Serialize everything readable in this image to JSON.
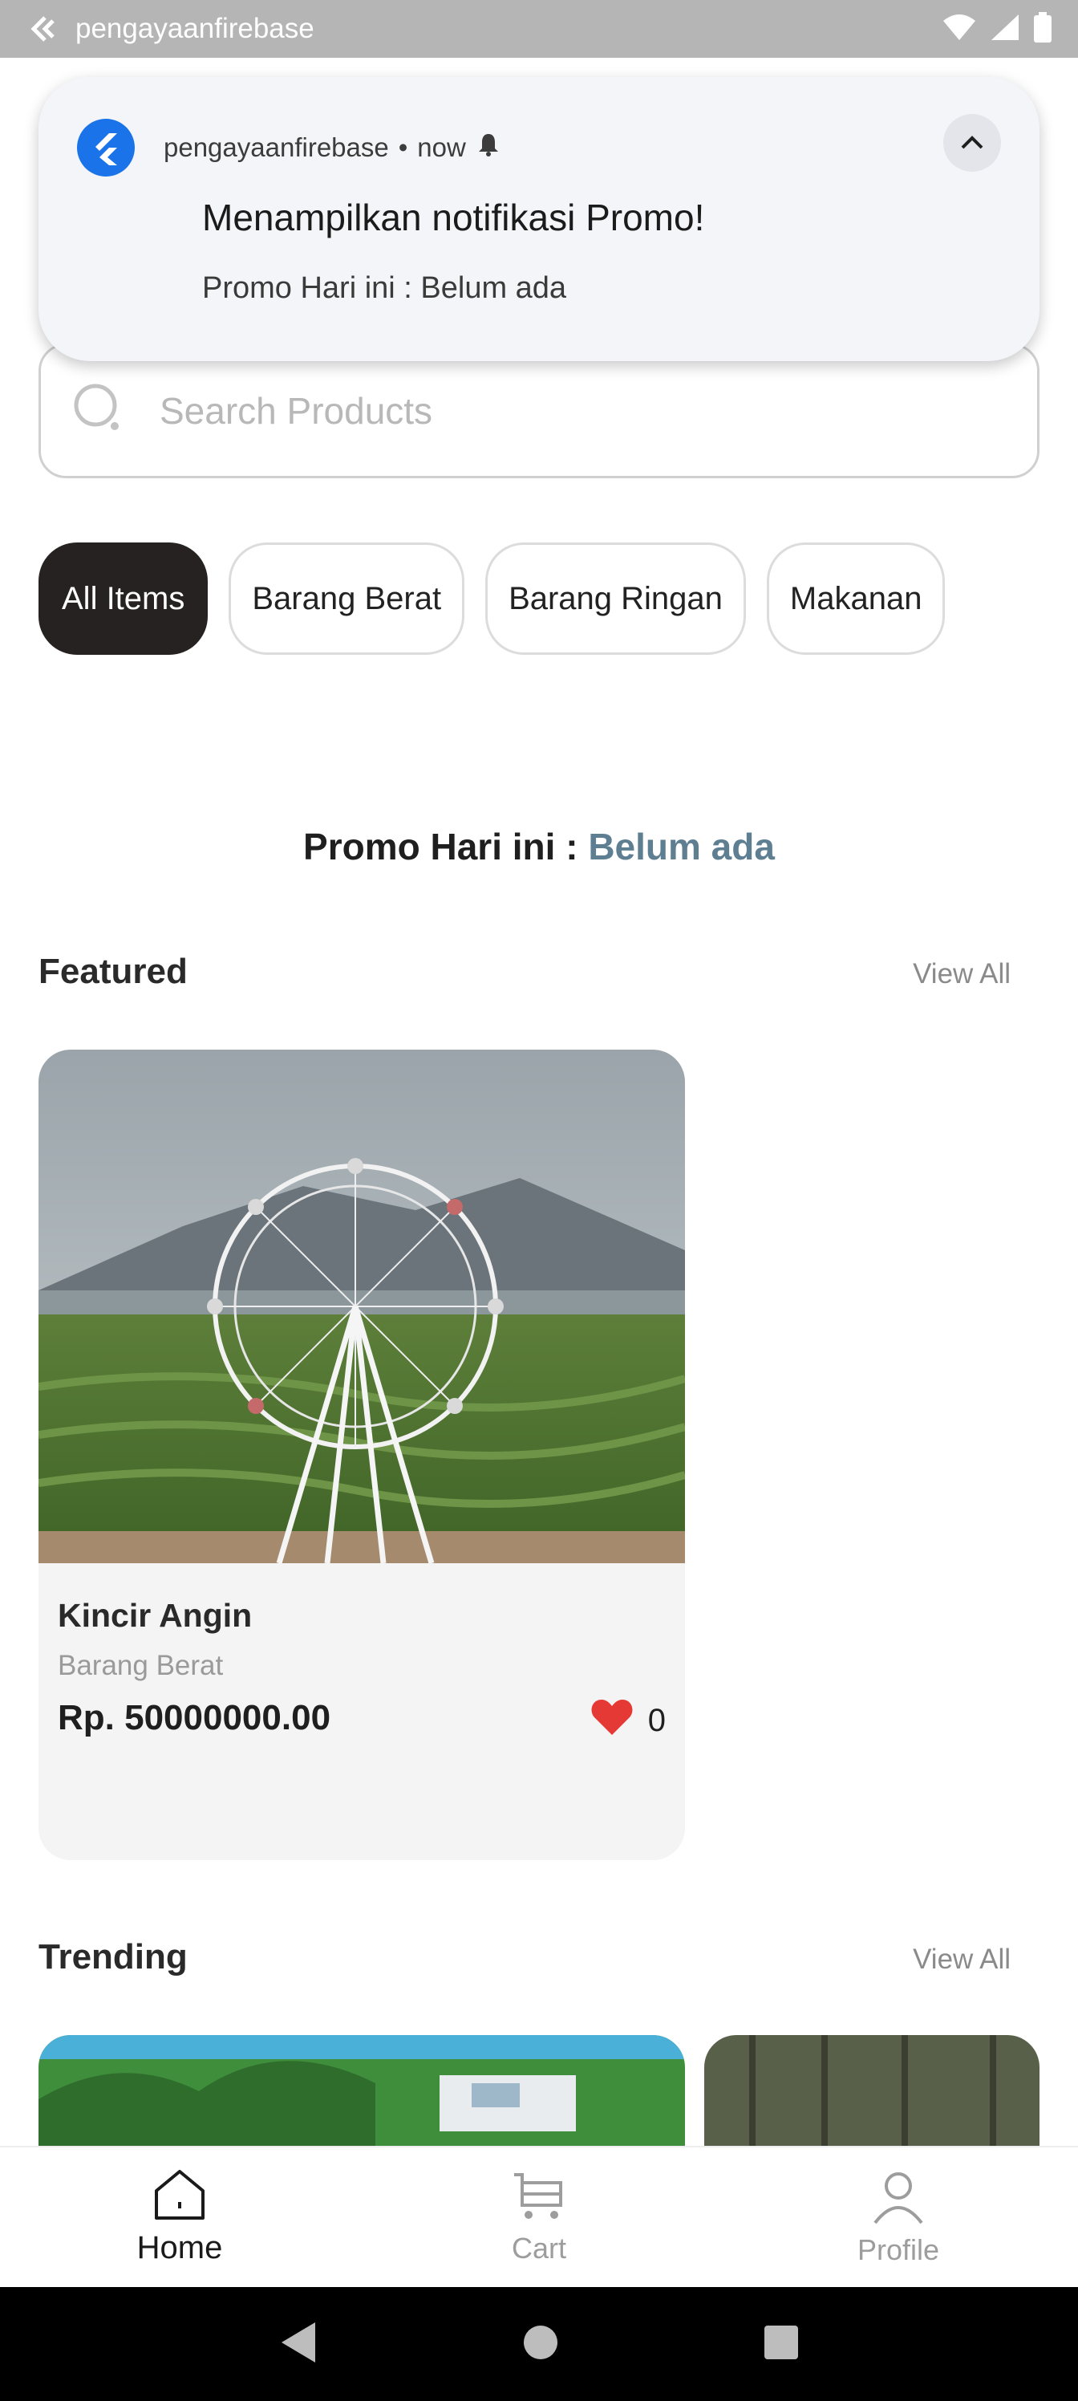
{
  "status_bar": {
    "app_name": "pengayaanfirebase",
    "icons": [
      "back-arrow-icon",
      "wifi-icon",
      "signal-icon",
      "battery-icon"
    ]
  },
  "notification": {
    "app_name": "pengayaanfirebase",
    "separator": "•",
    "time": "now",
    "title": "Menampilkan notifikasi Promo!",
    "body": "Promo Hari ini : Belum ada",
    "icons": [
      "flutter-logo-icon",
      "bell-icon",
      "chevron-up-icon"
    ]
  },
  "search": {
    "placeholder": "Search Products"
  },
  "categories": {
    "items": [
      {
        "label": "All Items",
        "active": true
      },
      {
        "label": "Barang Berat",
        "active": false
      },
      {
        "label": "Barang Ringan",
        "active": false
      },
      {
        "label": "Makanan",
        "active": false
      }
    ]
  },
  "promo": {
    "label": "Promo Hari ini : ",
    "value": "Belum ada",
    "value_color": "#5e7f92"
  },
  "featured": {
    "title": "Featured",
    "view_all": "View All",
    "products": [
      {
        "name": "Kincir Angin",
        "category": "Barang Berat",
        "price": "Rp. 50000000.00",
        "likes": "0",
        "image": "ferris-wheel-photo"
      }
    ]
  },
  "trending": {
    "title": "Trending",
    "view_all": "View All"
  },
  "bottom_nav": {
    "items": [
      {
        "label": "Home",
        "icon": "home-icon",
        "active": true
      },
      {
        "label": "Cart",
        "icon": "cart-icon",
        "active": false
      },
      {
        "label": "Profile",
        "icon": "profile-icon",
        "active": false
      }
    ]
  },
  "colors": {
    "chip_active_bg": "#272222",
    "heart": "#e53935",
    "status_bar_bg": "#b5b5b5"
  }
}
